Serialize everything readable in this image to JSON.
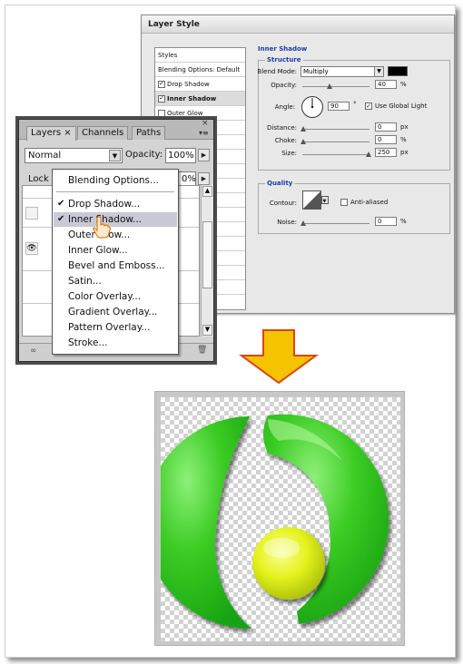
{
  "layer_style": {
    "title": "Layer Style",
    "list": [
      {
        "label": "Styles",
        "checkbox": false,
        "checked": false,
        "selected": false
      },
      {
        "label": "Blending Options: Default",
        "checkbox": false,
        "checked": false,
        "selected": false
      },
      {
        "label": "Drop Shadow",
        "checkbox": true,
        "checked": true,
        "selected": false
      },
      {
        "label": "Inner Shadow",
        "checkbox": true,
        "checked": true,
        "selected": true
      },
      {
        "label": "Outer Glow",
        "checkbox": true,
        "checked": false,
        "selected": false
      }
    ],
    "section_title": "Inner Shadow",
    "structure": {
      "label": "Structure",
      "blend_mode_label": "Blend Mode:",
      "blend_mode_value": "Multiply",
      "color": "#000000",
      "opacity_label": "Opacity:",
      "opacity_value": "40",
      "opacity_unit": "%",
      "opacity_level": 0.4,
      "angle_label": "Angle:",
      "angle_value": "90",
      "angle_unit": "°",
      "global_light_label": "Use Global Light",
      "global_light_checked": true,
      "distance_label": "Distance:",
      "distance_value": "0",
      "distance_unit": "px",
      "choke_label": "Choke:",
      "choke_value": "0",
      "choke_unit": "%",
      "size_label": "Size:",
      "size_value": "250",
      "size_unit": "px"
    },
    "quality": {
      "label": "Quality",
      "contour_label": "Contour:",
      "anti_aliased_label": "Anti-aliased",
      "anti_aliased_checked": false,
      "noise_label": "Noise:",
      "noise_value": "0",
      "noise_unit": "%"
    }
  },
  "layers_panel": {
    "tabs": [
      "Layers ×",
      "Channels",
      "Paths"
    ],
    "blend_mode": "Normal",
    "opacity_label": "Opacity:",
    "opacity_value": "100%",
    "lock_label": "Lock",
    "fill_value": "0%",
    "close_glyph": "×",
    "menu_glyph": "▾≡"
  },
  "context_menu": {
    "items": [
      {
        "label": "Blending Options...",
        "checked": false
      },
      {
        "label": "Drop Shadow...",
        "checked": true
      },
      {
        "label": "Inner Shadow...",
        "checked": true,
        "highlighted": true
      },
      {
        "label": "Outer Glow...",
        "checked": false
      },
      {
        "label": "Inner Glow...",
        "checked": false
      },
      {
        "label": "Bevel and Emboss...",
        "checked": false
      },
      {
        "label": "Satin...",
        "checked": false
      },
      {
        "label": "Color Overlay...",
        "checked": false
      },
      {
        "label": "Gradient Overlay...",
        "checked": false
      },
      {
        "label": "Pattern Overlay...",
        "checked": false
      },
      {
        "label": "Stroke...",
        "checked": false
      }
    ]
  },
  "colors": {
    "arrow_fill": "#f5c400",
    "arrow_stroke": "#e0421a",
    "logo_green": "#2ec21e",
    "logo_yellow": "#e2f01a"
  }
}
